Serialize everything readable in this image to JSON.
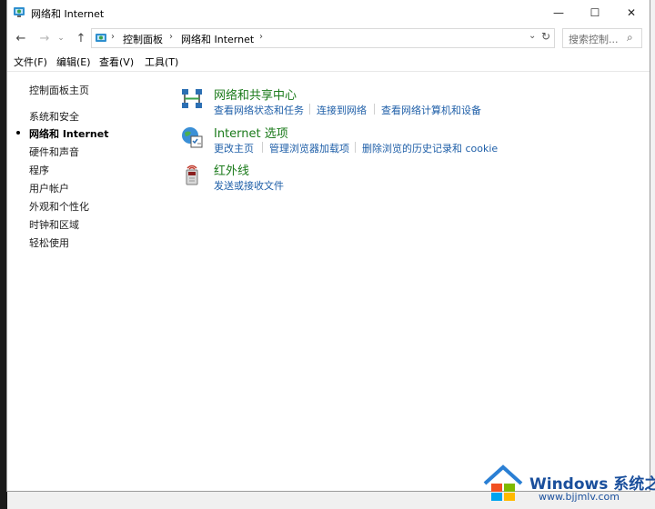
{
  "window": {
    "title": "网络和 Internet",
    "controls": {
      "minimize": "—",
      "maximize": "☐",
      "close": "✕"
    }
  },
  "nav": {
    "back_icon": "←",
    "forward_icon": "→",
    "recent_icon": "⌄",
    "up_icon": "↑",
    "crumbs": [
      "控制面板",
      "网络和 Internet"
    ],
    "separator": "›",
    "dropdown_icon": "⌄",
    "refresh_icon": "↻",
    "search_placeholder": "搜索控制...",
    "search_icon": "⌕"
  },
  "menu": [
    "文件(F)",
    "编辑(E)",
    "查看(V)",
    "工具(T)"
  ],
  "sidebar": {
    "home": "控制面板主页",
    "items": [
      "系统和安全",
      "网络和 Internet",
      "硬件和声音",
      "程序",
      "用户帐户",
      "外观和个性化",
      "时钟和区域",
      "轻松使用"
    ],
    "active_index": 1
  },
  "categories": [
    {
      "title": "网络和共享中心",
      "icon": "network-sharing-icon",
      "links": [
        "查看网络状态和任务",
        "连接到网络",
        "查看网络计算机和设备"
      ]
    },
    {
      "title": "Internet 选项",
      "icon": "internet-options-icon",
      "links": [
        "更改主页",
        "管理浏览器加载项",
        "删除浏览的历史记录和 cookie"
      ]
    },
    {
      "title": "红外线",
      "icon": "infrared-icon",
      "links": [
        "发送或接收文件"
      ]
    }
  ],
  "watermark": {
    "brand": "Windows 系统之家",
    "url": "www.bjjmlv.com"
  },
  "colors": {
    "category_title": "#1a7a1a",
    "link": "#1f5fa8",
    "accent": "#1a4f9c"
  }
}
